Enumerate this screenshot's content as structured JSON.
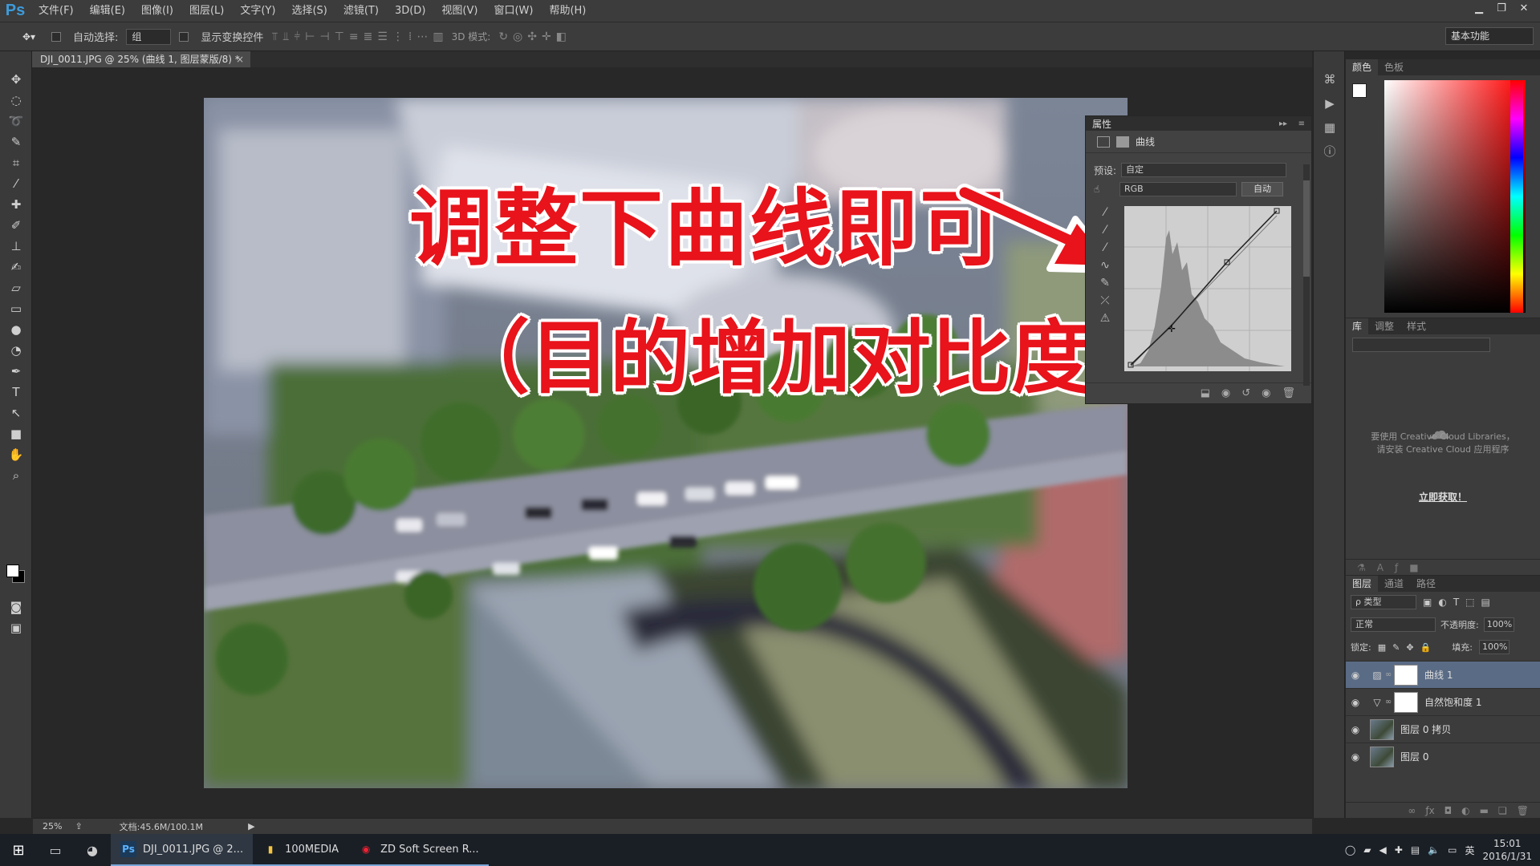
{
  "app": {
    "logo": "Ps",
    "menu": [
      "文件(F)",
      "编辑(E)",
      "图像(I)",
      "图层(L)",
      "文字(Y)",
      "选择(S)",
      "滤镜(T)",
      "3D(D)",
      "视图(V)",
      "窗口(W)",
      "帮助(H)"
    ],
    "window_controls": [
      "minimize-icon",
      "restore-icon",
      "close-icon"
    ]
  },
  "options": {
    "auto_select_label": "自动选择:",
    "auto_select_value": "组",
    "show_transform_label": "显示变换控件",
    "mode_3d_label": "3D 模式:",
    "workspace": "基本功能"
  },
  "document": {
    "tab_title": "DJI_0011.JPG @ 25% (曲线 1, 图层蒙版/8) *",
    "tab_close": "×"
  },
  "annotation": {
    "line1": "调整下曲线即可",
    "line2": "（目的增加对比度）",
    "color": "#e8131b"
  },
  "properties": {
    "panel_title": "属性",
    "adjustment_name": "曲线",
    "preset_label": "预设:",
    "preset_value": "自定",
    "channel_value": "RGB",
    "auto_button": "自动"
  },
  "color_panel": {
    "tabs": [
      "颜色",
      "色板"
    ],
    "foreground": "#ffffff",
    "background": "#000000"
  },
  "library_panel": {
    "tabs": [
      "库",
      "调整",
      "样式"
    ],
    "message_line1": "要使用 Creative Cloud Libraries，",
    "message_line2": "请安装 Creative Cloud 应用程序",
    "link": "立即获取！"
  },
  "layers_panel": {
    "tabs": [
      "图层",
      "通道",
      "路径"
    ],
    "filter": "ρ 类型",
    "blend_mode": "正常",
    "opacity_label": "不透明度:",
    "opacity_value": "100%",
    "lock_label": "锁定:",
    "fill_label": "填充:",
    "fill_value": "100%",
    "layers": [
      {
        "name": "曲线 1",
        "type": "curves",
        "selected": true
      },
      {
        "name": "自然饱和度 1",
        "type": "vibrance",
        "selected": false
      },
      {
        "name": "图层 0 拷贝",
        "type": "image",
        "selected": false
      },
      {
        "name": "图层 0",
        "type": "image",
        "selected": false
      }
    ]
  },
  "status": {
    "zoom": "25%",
    "doc_size": "文档:45.6M/100.1M"
  },
  "taskbar": {
    "apps": [
      {
        "label": "DJI_0011.JPG @ 2...",
        "icon": "Ps",
        "active": true
      },
      {
        "label": "100MEDIA",
        "icon": "folder-icon",
        "active": false
      },
      {
        "label": "ZD Soft Screen R...",
        "icon": "record-icon",
        "active": false
      }
    ],
    "ime": "英",
    "time": "15:01",
    "date": "2016/1/31"
  }
}
